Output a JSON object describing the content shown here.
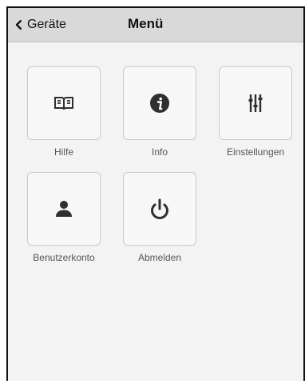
{
  "header": {
    "back_label": "Geräte",
    "title": "Menü"
  },
  "menu": {
    "items": [
      {
        "label": "Hilfe",
        "icon": "book-icon"
      },
      {
        "label": "Info",
        "icon": "info-icon"
      },
      {
        "label": "Einstellungen",
        "icon": "sliders-icon"
      },
      {
        "label": "Benutzerkonto",
        "icon": "user-icon"
      },
      {
        "label": "Abmelden",
        "icon": "power-icon"
      }
    ]
  },
  "colors": {
    "header_bg": "#d9d9d9",
    "page_bg": "#f3f3f3",
    "tile_bg": "#f7f7f7",
    "icon_color": "#2f2f2f"
  }
}
